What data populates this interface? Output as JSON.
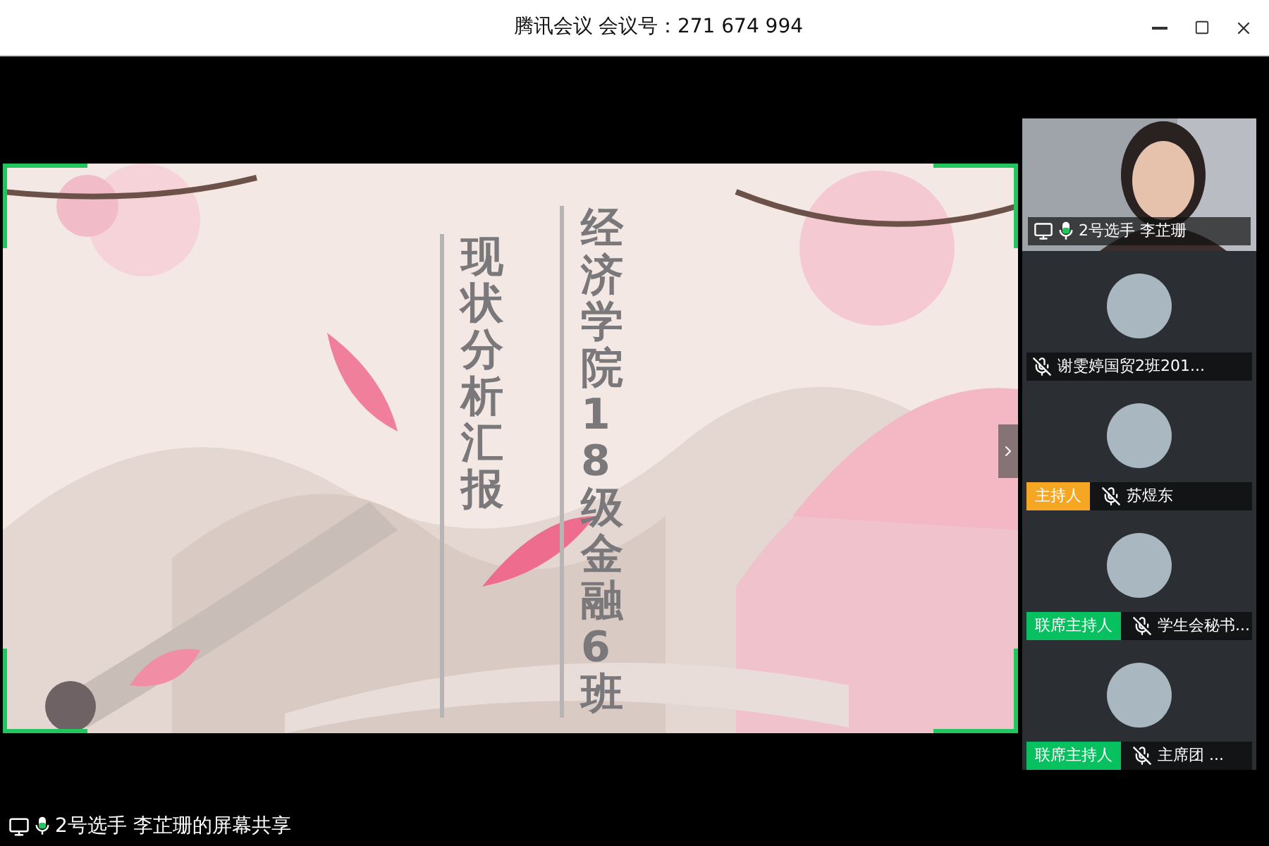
{
  "window": {
    "app": "腾讯会议",
    "meeting_id": "会议号：271 674 994"
  },
  "slide": {
    "title": "现状分析汇报",
    "subtitle": "经济学院18级金融6班"
  },
  "participants": [
    {
      "kind": "video",
      "name": "2号选手 李芷珊",
      "muted": false,
      "sharing": true
    },
    {
      "kind": "avatar",
      "name": "谢雯婷国贸2班201...",
      "muted": true
    },
    {
      "kind": "avatar",
      "name": "苏煜东",
      "muted": true,
      "role": "主持人",
      "color": "#f5a623"
    },
    {
      "kind": "avatar",
      "name": "学生会秘书...",
      "muted": true,
      "role": "联席主持人",
      "color": "#07c160"
    },
    {
      "kind": "avatar",
      "name": "主席团 ...",
      "muted": true,
      "role": "联席主持人",
      "color": "#07c160"
    }
  ],
  "status": {
    "sharing": true,
    "muted": false,
    "text": "2号选手 李芷珊的屏幕共享"
  }
}
